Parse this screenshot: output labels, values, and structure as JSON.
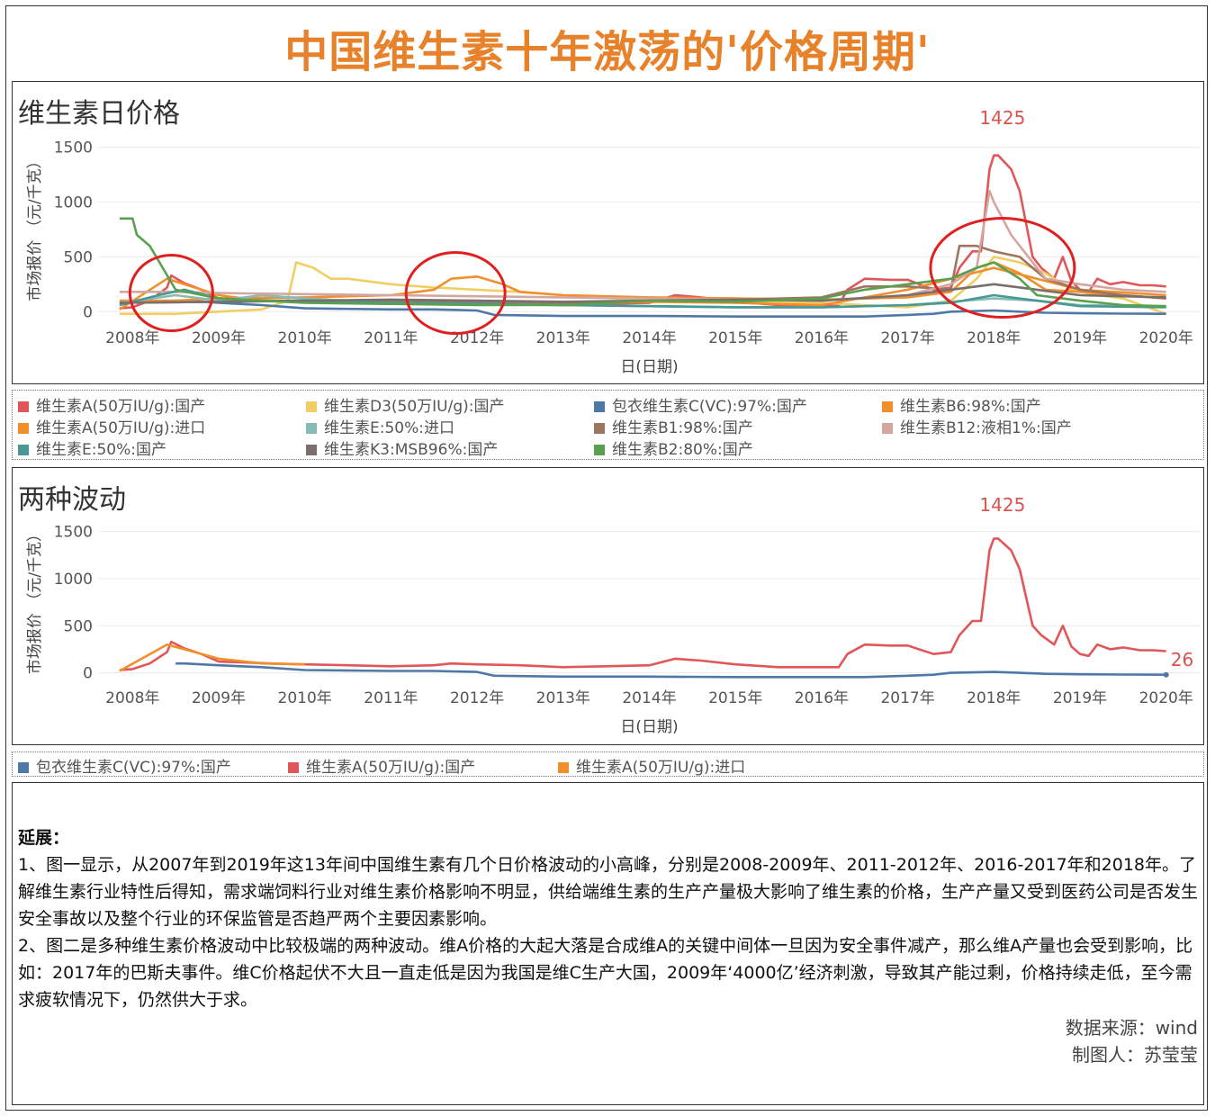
{
  "title": "中国维生素十年激荡的'价格周期'",
  "chart1": {
    "panel_title": "维生素日价格",
    "ylabel": "市场报价 （元/千克）",
    "xlabel": "日(日期)",
    "peak_label": "1425"
  },
  "chart2": {
    "panel_title": "两种波动",
    "ylabel": "市场报价 （元/千克）",
    "xlabel": "日(日期)",
    "peak_label": "1425",
    "end_label": "26"
  },
  "legend1": [
    {
      "label": "维生素A(50万IU/g):国产",
      "color": "#e05759"
    },
    {
      "label": "维生素D3(50万IU/g):国产",
      "color": "#f1ce63"
    },
    {
      "label": "包衣维生素C(VC):97%:国产",
      "color": "#4e79a7"
    },
    {
      "label": "维生素B6:98%:国产",
      "color": "#f28e2b"
    },
    {
      "label": "维生素A(50万IU/g):进口",
      "color": "#f28e2b"
    },
    {
      "label": "维生素E:50%:进口",
      "color": "#86bcb6"
    },
    {
      "label": "维生素B1:98%:国产",
      "color": "#9d7660"
    },
    {
      "label": "维生素B12:液相1%:国产",
      "color": "#d4a6a0"
    },
    {
      "label": "维生素E:50%:国产",
      "color": "#499894"
    },
    {
      "label": "维生素K3:MSB96%:国产",
      "color": "#79706e"
    },
    {
      "label": "维生素B2:80%:国产",
      "color": "#59a14f"
    }
  ],
  "legend2": [
    {
      "label": "包衣维生素C(VC):97%:国产",
      "color": "#4e79a7"
    },
    {
      "label": "维生素A(50万IU/g):国产",
      "color": "#e05759"
    },
    {
      "label": "维生素A(50万IU/g):进口",
      "color": "#f28e2b"
    }
  ],
  "text": {
    "heading": "延展：",
    "p1": "1、图一显示，从2007年到2019年这13年间中国维生素有几个日价格波动的小高峰，分别是2008-2009年、2011-2012年、2016-2017年和2018年。了解维生素行业特性后得知，需求端饲料行业对维生素价格影响不明显，供给端维生素的生产产量极大影响了维生素的价格，生产产量又受到医药公司是否发生安全事故以及整个行业的环保监管是否趋严两个主要因素影响。",
    "p2": "2、图二是多种维生素价格波动中比较极端的两种波动。维A价格的大起大落是合成维A的关键中间体一旦因为安全事件减产，那么维A产量也会受到影响，比如：2017年的巴斯夫事件。维C价格起伏不大且一直走低是因为我国是维C生产大国，2009年‘4000亿’经济刺激，导致其产能过剩，价格持续走低，至今需求疲软情况下，仍然供大于求。",
    "source": "数据来源：wind",
    "author": "制图人：苏莹莹"
  },
  "chart_data": [
    {
      "type": "line",
      "title": "维生素日价格",
      "xlabel": "日(日期)",
      "ylabel": "市场报价 （元/千克）",
      "x_ticks": [
        "2008年",
        "2009年",
        "2010年",
        "2011年",
        "2012年",
        "2013年",
        "2014年",
        "2015年",
        "2016年",
        "2017年",
        "2018年",
        "2019年",
        "2020年"
      ],
      "y_ticks": [
        0,
        500,
        1000,
        1500
      ],
      "ylim": [
        -80,
        1620
      ],
      "xlim": [
        2007.6,
        2020.4
      ],
      "grid": true,
      "annotations": [
        {
          "text": "1425",
          "x": 2018.1,
          "y": 1425
        }
      ],
      "series": [
        {
          "name": "维生素A(50万IU/g):国产",
          "color": "#e05759",
          "x": [
            2007.85,
            2008.0,
            2008.2,
            2008.4,
            2008.45,
            2008.6,
            2008.8,
            2009.0,
            2009.3,
            2009.6,
            2010.0,
            2010.5,
            2011.0,
            2011.5,
            2011.7,
            2012.0,
            2012.5,
            2013.0,
            2013.5,
            2014.0,
            2014.3,
            2014.6,
            2015.0,
            2015.5,
            2016.0,
            2016.2,
            2016.3,
            2016.5,
            2016.8,
            2017.0,
            2017.3,
            2017.5,
            2017.6,
            2017.75,
            2017.85,
            2017.95,
            2018.0,
            2018.05,
            2018.2,
            2018.3,
            2018.4,
            2018.45,
            2018.55,
            2018.7,
            2018.8,
            2018.9,
            2019.0,
            2019.1,
            2019.2,
            2019.35,
            2019.5,
            2019.7,
            2019.85,
            2020.0
          ],
          "y": [
            30,
            40,
            100,
            220,
            330,
            260,
            200,
            120,
            110,
            100,
            90,
            80,
            70,
            80,
            100,
            90,
            80,
            60,
            70,
            80,
            150,
            130,
            90,
            60,
            60,
            60,
            200,
            300,
            290,
            290,
            200,
            220,
            400,
            550,
            550,
            1300,
            1425,
            1425,
            1300,
            1100,
            700,
            500,
            400,
            300,
            500,
            280,
            200,
            180,
            300,
            250,
            270,
            240,
            240,
            230
          ]
        },
        {
          "name": "维生素D3(50万IU/g):国产",
          "color": "#f1ce63",
          "x": [
            2007.85,
            2008.5,
            2009.0,
            2009.5,
            2009.8,
            2009.9,
            2010.1,
            2010.3,
            2010.5,
            2011.0,
            2011.5,
            2012.0,
            2012.5,
            2013.0,
            2014.0,
            2015.0,
            2016.0,
            2016.5,
            2017.0,
            2017.5,
            2017.8,
            2018.0,
            2018.3,
            2018.6,
            2018.9,
            2019.2,
            2019.5,
            2020.0
          ],
          "y": [
            -20,
            -20,
            0,
            20,
            100,
            450,
            400,
            300,
            300,
            250,
            220,
            200,
            180,
            150,
            100,
            90,
            80,
            60,
            40,
            100,
            300,
            500,
            450,
            350,
            200,
            150,
            120,
            -20
          ]
        },
        {
          "name": "包衣维生素C(VC):97%:国产",
          "color": "#4e79a7",
          "x": [
            2008.5,
            2008.6,
            2009.0,
            2009.5,
            2010.0,
            2011.0,
            2011.5,
            2012.0,
            2012.2,
            2013.0,
            2014.0,
            2015.0,
            2016.0,
            2016.5,
            2017.0,
            2017.3,
            2017.5,
            2018.0,
            2018.3,
            2018.6,
            2019.0,
            2019.5,
            2020.0
          ],
          "y": [
            100,
            100,
            80,
            60,
            30,
            20,
            20,
            10,
            -30,
            -40,
            -40,
            -45,
            -45,
            -45,
            -30,
            -20,
            0,
            10,
            0,
            -10,
            -15,
            -18,
            -20
          ]
        },
        {
          "name": "维生素B6:98%:国产",
          "color": "#f28e2b",
          "x": [
            2007.85,
            2008.5,
            2009.0,
            2010.0,
            2011.0,
            2011.5,
            2011.7,
            2012.0,
            2012.3,
            2012.5,
            2013.0,
            2014.0,
            2015.0,
            2016.0,
            2017.0,
            2017.5,
            2017.8,
            2018.0,
            2018.3,
            2018.6,
            2019.0,
            2019.5,
            2020.0
          ],
          "y": [
            100,
            100,
            120,
            130,
            150,
            200,
            300,
            320,
            250,
            180,
            150,
            130,
            120,
            110,
            130,
            180,
            400,
            450,
            350,
            200,
            180,
            150,
            120
          ]
        },
        {
          "name": "维生素A(50万IU/g):进口",
          "color": "#f28e2b",
          "x": [
            2007.85,
            2008.4,
            2008.6,
            2009.0,
            2009.5,
            2010.0,
            2011.0,
            2012.0,
            2013.0,
            2014.0,
            2015.0,
            2016.0,
            2017.0,
            2018.0,
            2018.5,
            2019.0,
            2020.0
          ],
          "y": [
            20,
            300,
            250,
            150,
            100,
            90,
            80,
            100,
            70,
            90,
            80,
            60,
            200,
            400,
            300,
            200,
            150
          ]
        },
        {
          "name": "维生素E:50%:进口",
          "color": "#86bcb6",
          "x": [
            2007.85,
            2008.5,
            2009.0,
            2009.5,
            2010.0,
            2010.5,
            2011.0,
            2012.0,
            2013.0,
            2014.0,
            2015.0,
            2016.0,
            2017.0,
            2018.0,
            2018.5,
            2019.0,
            2020.0
          ],
          "y": [
            80,
            150,
            100,
            150,
            120,
            100,
            90,
            70,
            60,
            50,
            40,
            40,
            60,
            120,
            100,
            60,
            50
          ]
        },
        {
          "name": "维生素B1:98%:国产",
          "color": "#9d7660",
          "x": [
            2007.85,
            2009.0,
            2010.0,
            2011.0,
            2012.0,
            2013.0,
            2014.0,
            2015.0,
            2016.0,
            2016.5,
            2017.0,
            2017.5,
            2017.6,
            2017.8,
            2018.0,
            2018.3,
            2018.6,
            2019.0,
            2019.5,
            2020.0
          ],
          "y": [
            80,
            90,
            100,
            100,
            90,
            80,
            100,
            110,
            130,
            230,
            230,
            200,
            600,
            600,
            550,
            500,
            300,
            200,
            150,
            120
          ]
        },
        {
          "name": "维生素B12:液相1%:国产",
          "color": "#d4a6a0",
          "x": [
            2007.85,
            2008.5,
            2009.0,
            2010.0,
            2011.0,
            2012.0,
            2013.0,
            2014.0,
            2015.0,
            2016.0,
            2017.0,
            2017.5,
            2017.8,
            2017.95,
            2018.0,
            2018.2,
            2018.4,
            2018.6,
            2019.0,
            2019.5,
            2020.0
          ],
          "y": [
            180,
            180,
            170,
            160,
            150,
            140,
            130,
            120,
            110,
            100,
            150,
            250,
            400,
            1100,
            1000,
            700,
            500,
            300,
            250,
            200,
            180
          ]
        },
        {
          "name": "维生素E:50%:国产",
          "color": "#499894",
          "x": [
            2007.85,
            2008.3,
            2008.6,
            2009.0,
            2009.5,
            2010.0,
            2011.0,
            2012.0,
            2013.0,
            2014.0,
            2015.0,
            2016.0,
            2016.5,
            2017.0,
            2017.5,
            2018.0,
            2018.5,
            2019.0,
            2020.0
          ],
          "y": [
            60,
            150,
            200,
            120,
            100,
            100,
            80,
            70,
            60,
            50,
            40,
            40,
            50,
            60,
            80,
            150,
            100,
            50,
            40
          ]
        },
        {
          "name": "维生素K3:MSB96%:国产",
          "color": "#79706e",
          "x": [
            2007.85,
            2009.0,
            2010.0,
            2011.0,
            2012.0,
            2013.0,
            2014.0,
            2015.0,
            2016.0,
            2017.0,
            2017.5,
            2018.0,
            2018.5,
            2019.0,
            2020.0
          ],
          "y": [
            80,
            90,
            100,
            110,
            100,
            90,
            100,
            110,
            100,
            150,
            200,
            250,
            200,
            150,
            130
          ]
        },
        {
          "name": "维生素B2:80%:国产",
          "color": "#59a14f",
          "x": [
            2007.85,
            2008.0,
            2008.05,
            2008.2,
            2008.35,
            2008.5,
            2009.0,
            2009.5,
            2010.0,
            2011.0,
            2012.0,
            2013.0,
            2014.0,
            2015.0,
            2016.0,
            2016.5,
            2017.0,
            2017.5,
            2017.8,
            2018.0,
            2018.3,
            2018.5,
            2019.0,
            2019.5,
            2020.0
          ],
          "y": [
            850,
            850,
            700,
            600,
            400,
            200,
            120,
            100,
            80,
            70,
            60,
            60,
            100,
            90,
            120,
            200,
            250,
            300,
            400,
            450,
            300,
            150,
            100,
            60,
            50
          ]
        }
      ]
    },
    {
      "type": "line",
      "title": "两种波动",
      "xlabel": "日(日期)",
      "ylabel": "市场报价 （元/千克）",
      "x_ticks": [
        "2008年",
        "2009年",
        "2010年",
        "2011年",
        "2012年",
        "2013年",
        "2014年",
        "2015年",
        "2016年",
        "2017年",
        "2018年",
        "2019年",
        "2020年"
      ],
      "y_ticks": [
        0,
        500,
        1000,
        1500
      ],
      "ylim": [
        -80,
        1620
      ],
      "xlim": [
        2007.6,
        2020.4
      ],
      "grid": true,
      "annotations": [
        {
          "text": "1425",
          "x": 2018.1,
          "y": 1425
        },
        {
          "text": "26",
          "x": 2020.0,
          "y": 26
        }
      ],
      "series": [
        {
          "name": "包衣维生素C(VC):97%:国产",
          "color": "#4e79a7",
          "x": [
            2008.5,
            2008.6,
            2009.0,
            2009.5,
            2010.0,
            2011.0,
            2011.5,
            2012.0,
            2012.2,
            2013.0,
            2014.0,
            2015.0,
            2016.0,
            2016.5,
            2017.0,
            2017.3,
            2017.5,
            2018.0,
            2018.3,
            2018.6,
            2019.0,
            2019.5,
            2020.0
          ],
          "y": [
            100,
            100,
            80,
            60,
            30,
            20,
            20,
            10,
            -30,
            -40,
            -40,
            -45,
            -45,
            -45,
            -30,
            -20,
            0,
            10,
            0,
            -10,
            -15,
            -18,
            -20
          ]
        },
        {
          "name": "维生素A(50万IU/g):国产",
          "color": "#e05759",
          "x": [
            2007.85,
            2008.0,
            2008.2,
            2008.4,
            2008.45,
            2008.6,
            2008.8,
            2009.0,
            2009.3,
            2009.6,
            2010.0,
            2010.5,
            2011.0,
            2011.5,
            2011.7,
            2012.0,
            2012.5,
            2013.0,
            2013.5,
            2014.0,
            2014.3,
            2014.6,
            2015.0,
            2015.5,
            2016.0,
            2016.2,
            2016.3,
            2016.5,
            2016.8,
            2017.0,
            2017.3,
            2017.5,
            2017.6,
            2017.75,
            2017.85,
            2017.95,
            2018.0,
            2018.05,
            2018.2,
            2018.3,
            2018.4,
            2018.45,
            2018.55,
            2018.7,
            2018.8,
            2018.9,
            2019.0,
            2019.1,
            2019.2,
            2019.35,
            2019.5,
            2019.7,
            2019.85,
            2020.0
          ],
          "y": [
            30,
            40,
            100,
            220,
            330,
            260,
            200,
            120,
            110,
            100,
            90,
            80,
            70,
            80,
            100,
            90,
            80,
            60,
            70,
            80,
            150,
            130,
            90,
            60,
            60,
            60,
            200,
            300,
            290,
            290,
            200,
            220,
            400,
            550,
            550,
            1300,
            1425,
            1425,
            1300,
            1100,
            700,
            500,
            400,
            300,
            500,
            280,
            200,
            180,
            300,
            250,
            270,
            240,
            240,
            230
          ]
        },
        {
          "name": "维生素A(50万IU/g):进口",
          "color": "#f28e2b",
          "x": [
            2007.85,
            2008.4,
            2008.6,
            2009.0,
            2009.5,
            2010.0
          ],
          "y": [
            20,
            300,
            250,
            150,
            100,
            90
          ]
        }
      ]
    }
  ]
}
